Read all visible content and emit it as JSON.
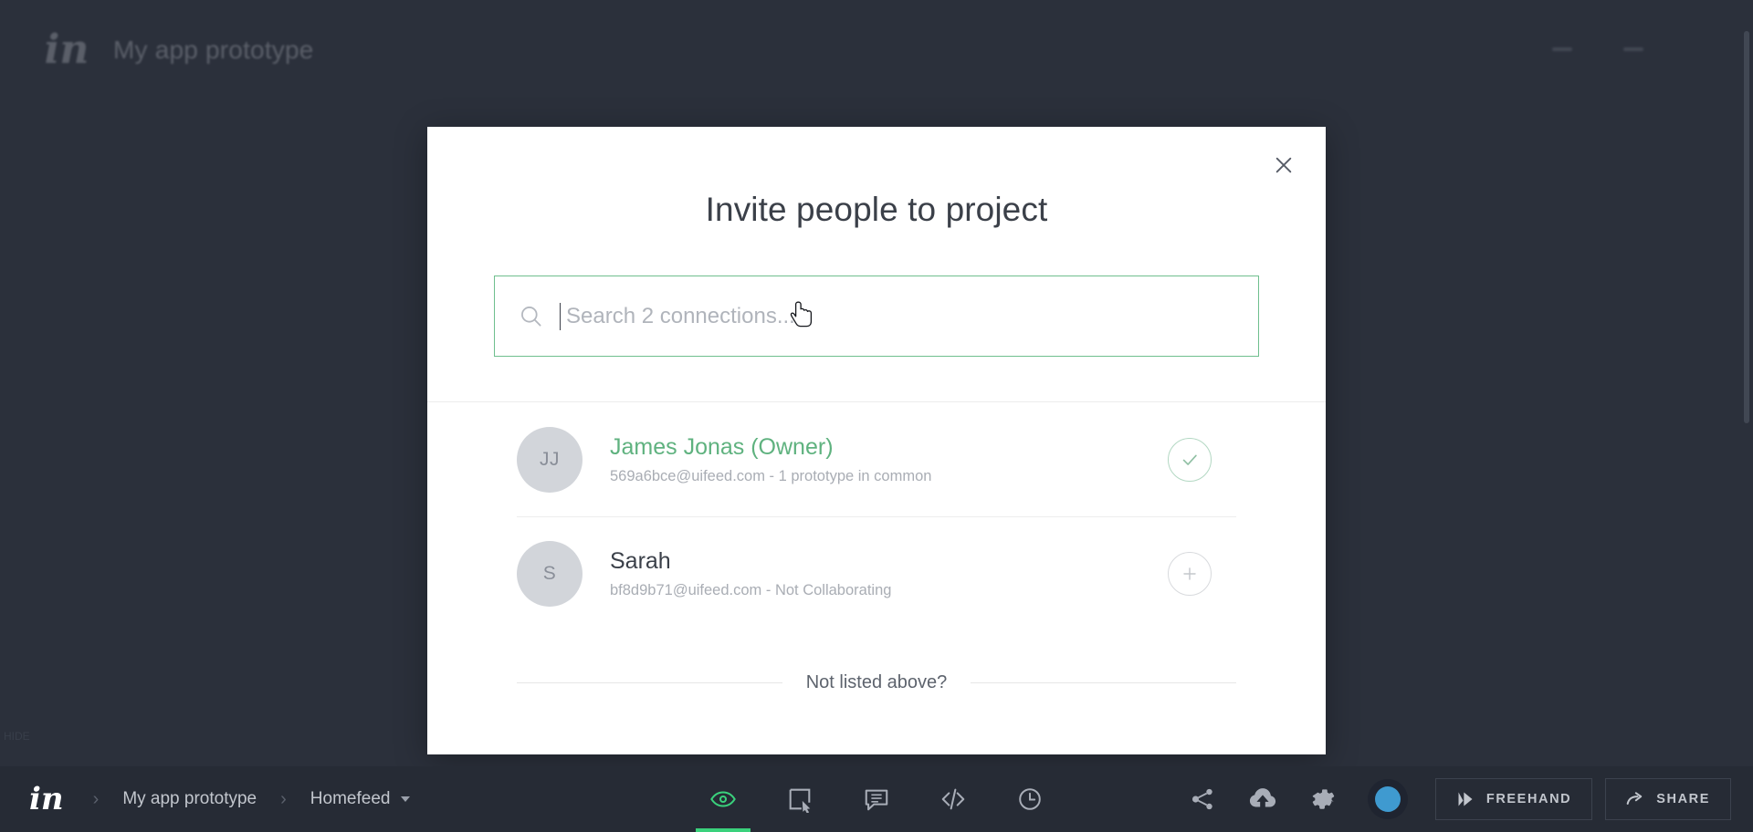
{
  "background": {
    "logo": "in",
    "project_title": "My app prototype",
    "faint_label": "HIDE"
  },
  "modal": {
    "title": "Invite people to project",
    "close_label": "×",
    "search": {
      "placeholder": "Search 2 connections...",
      "value": ""
    },
    "people": [
      {
        "initials": "JJ",
        "name": "James Jonas (Owner)",
        "subtitle": "569a6bce@uifeed.com - 1 prototype in common",
        "is_owner": true,
        "action": "checked",
        "action_label": "Collaborating"
      },
      {
        "initials": "S",
        "name": "Sarah",
        "subtitle": "bf8d9b71@uifeed.com - Not Collaborating",
        "is_owner": false,
        "action": "add",
        "action_label": "Add"
      }
    ],
    "not_listed_label": "Not listed above?"
  },
  "toolbar": {
    "logo": "in",
    "breadcrumb": [
      {
        "label": "My app prototype",
        "has_caret": false
      },
      {
        "label": "Homefeed",
        "has_caret": true
      }
    ],
    "separator": "›",
    "center_tools": [
      {
        "name": "preview-eye",
        "label": "Preview",
        "active": true
      },
      {
        "name": "hotspot",
        "label": "Hotspots",
        "active": false
      },
      {
        "name": "comment",
        "label": "Comments",
        "active": false
      },
      {
        "name": "inspect-code",
        "label": "Inspect",
        "active": false
      },
      {
        "name": "history",
        "label": "History",
        "active": false
      }
    ],
    "right_tools": [
      {
        "name": "share-nodes",
        "label": "Share links"
      },
      {
        "name": "cloud-upload",
        "label": "Upload"
      },
      {
        "name": "settings-gear",
        "label": "Settings"
      }
    ],
    "freehand_label": "FREEHAND",
    "share_label": "SHARE"
  },
  "colors": {
    "accent_green": "#3ad17c",
    "owner_green": "#5fb27f",
    "toolbar_bg": "#262b35",
    "canvas_bg": "#2b303b",
    "avatar_blue": "#3f9ad0"
  }
}
